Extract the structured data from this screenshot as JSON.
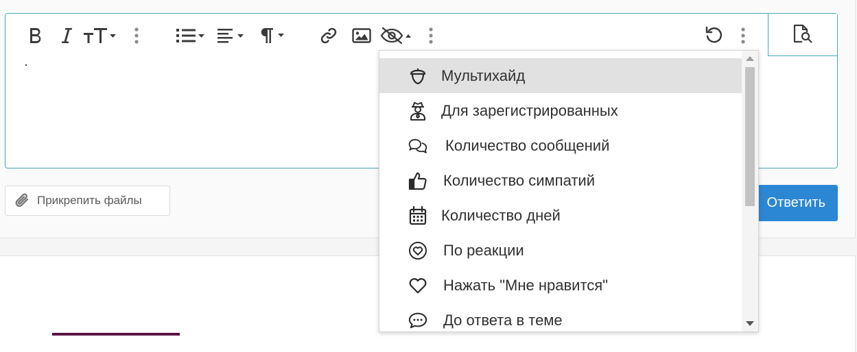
{
  "toolbar": {
    "buttons": [
      "bold-icon",
      "italic-icon",
      "text-size-icon",
      "more-vert-icon",
      "list-icon",
      "align-icon",
      "paragraph-icon",
      "link-icon",
      "image-icon",
      "hide-icon",
      "more-vert-icon",
      "undo-icon",
      "more-vert-icon"
    ],
    "preview_icon": "preview-search-icon"
  },
  "attach_label": "Прикрепить файлы",
  "submit_label": "Ответить",
  "menu": {
    "items": [
      {
        "label": "Мультихайд",
        "icon": "acorn-icon",
        "active": true
      },
      {
        "label": "Для зарегистрированных",
        "icon": "user-secret-icon"
      },
      {
        "label": "Количество сообщений",
        "icon": "comments-icon"
      },
      {
        "label": "Количество симпатий",
        "icon": "thumbs-up-icon"
      },
      {
        "label": "Количество дней",
        "icon": "calendar-icon"
      },
      {
        "label": "По реакции",
        "icon": "heart-circle-icon"
      },
      {
        "label": "Нажать \"Мне нравится\"",
        "icon": "heart-icon"
      },
      {
        "label": "До ответа в теме",
        "icon": "comment-dots-icon"
      }
    ]
  }
}
